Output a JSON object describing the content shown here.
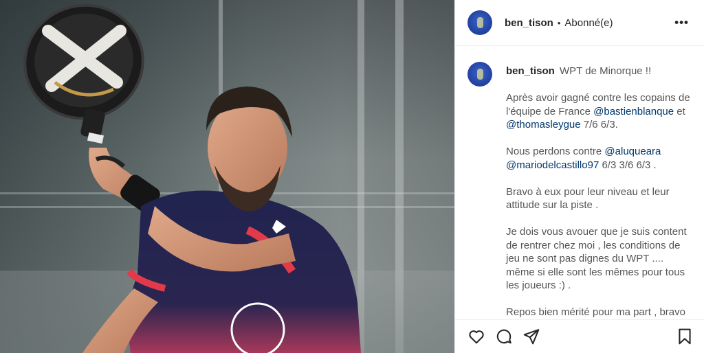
{
  "post": {
    "username": "ben_tison",
    "separator": "•",
    "follow_status": "Abonné(e)",
    "more_label": "•••"
  },
  "caption": {
    "username": "ben_tison",
    "first_line": "WPT de Minorque !!",
    "p1_a": "Après avoir gagné contre les copains de l'équipe de France ",
    "p1_m1": "@bastienblanque",
    "p1_b": " et ",
    "p1_m2": "@thomasleygue",
    "p1_c": " 7/6 6/3.",
    "p2_a": "Nous perdons contre ",
    "p2_m1": "@aluqueara",
    "p2_b": " ",
    "p2_m2": "@mariodelcastillo97",
    "p2_c": " 6/3 3/6 6/3 .",
    "p3": "Bravo à eux pour leur niveau et leur attitude sur la piste .",
    "p4": "Je dois vous avouer que je suis content de rentrer chez moi , les conditions de jeu ne sont pas dignes du WPT .... même si elle sont les mêmes pour tous les joueurs :) .",
    "p5": "Repos bien mérité pour ma part , bravo"
  },
  "icons": {
    "like": "heart-icon",
    "comment": "comment-icon",
    "share": "paper-plane-icon",
    "save": "bookmark-icon",
    "more": "more-options-icon"
  },
  "colors": {
    "text": "#262626",
    "mention": "#00376b",
    "secondary_text": "#555555",
    "divider": "#efefef",
    "shirt": "#1f2350",
    "shirt_accent": "#e23a4a"
  }
}
